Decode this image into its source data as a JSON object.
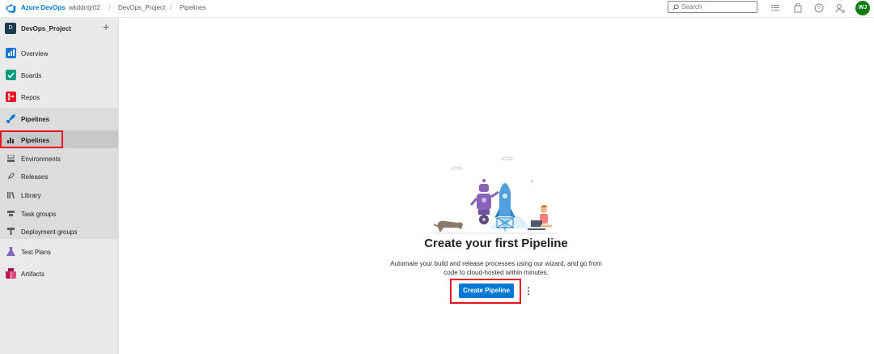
{
  "topbar": {
    "brand": "Azure DevOps",
    "breadcrumbs": [
      "wkddntjr02",
      "DevOps_Project",
      "Pipelines"
    ],
    "separator": "/",
    "search_placeholder": "Search",
    "icons": [
      "list-icon",
      "shopping-bag-icon",
      "help-icon",
      "user-settings-icon"
    ],
    "avatar_initials": "WJ"
  },
  "sidebar": {
    "project_initial": "D",
    "project_name": "DevOps_Project",
    "add_label": "+",
    "items": [
      {
        "label": "Overview",
        "icon": "overview-icon",
        "color": "#0078d4"
      },
      {
        "label": "Boards",
        "icon": "boards-icon",
        "color": "#009a7c"
      },
      {
        "label": "Repos",
        "icon": "repos-icon",
        "color": "#e81123"
      },
      {
        "label": "Pipelines",
        "icon": "pipelines-icon",
        "color": "#0078d4"
      },
      {
        "label": "Test Plans",
        "icon": "test-plans-icon",
        "color": "#8764b8"
      },
      {
        "label": "Artifacts",
        "icon": "artifacts-icon",
        "color": "#c2185b"
      }
    ],
    "pipelines_sub": [
      {
        "label": "Pipelines",
        "icon": "pipelines-bars-icon"
      },
      {
        "label": "Environments",
        "icon": "environments-icon"
      },
      {
        "label": "Releases",
        "icon": "releases-icon"
      },
      {
        "label": "Library",
        "icon": "library-icon"
      },
      {
        "label": "Task groups",
        "icon": "task-groups-icon"
      },
      {
        "label": "Deployment groups",
        "icon": "deployment-groups-icon"
      }
    ]
  },
  "main": {
    "title": "Create your first Pipeline",
    "description": "Automate your build and release processes using our wizard, and go from code to cloud-hosted within minutes.",
    "cta_label": "Create Pipeline",
    "more_label": "⋮"
  },
  "colors": {
    "accent": "#0078d4",
    "highlight": "#e81123",
    "sidebar_bg": "#eaeaea",
    "avatar_bg": "#107c10"
  }
}
